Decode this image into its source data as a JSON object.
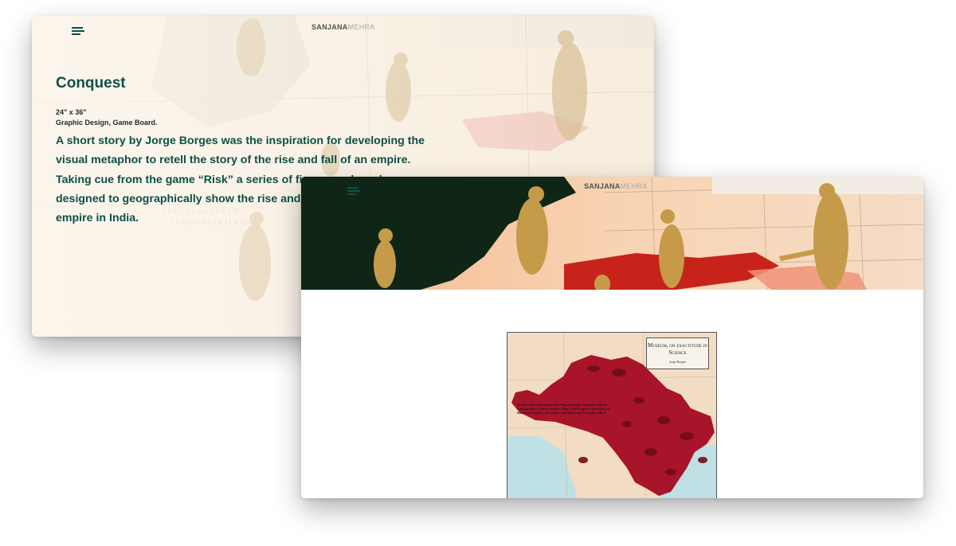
{
  "back_window": {
    "logo_first": "SANJANA",
    "logo_last": "MEHRA",
    "project": {
      "title": "Conquest",
      "size": "24\" x 36\"",
      "category": "Graphic Design, Game Board.",
      "description": "A short story by Jorge Borges was the inspiration for developing the visual metaphor to retell the story of the rise and fall of an empire. Taking cue from the game “Risk” a series of five game boards was designed to geographically show the rise and fall of the British empire in India."
    }
  },
  "front_window": {
    "logo_first": "SANJANA",
    "logo_last": "MEHRA",
    "poster": {
      "label_title": "Museum, on exactitude in Science",
      "label_author": "Jorge Borges",
      "map_text": "In time, those unconscionable Maps no longer satisfied, and the Cartographers Guilds struck a Map of the Empire whose size was that of the Empire, and which coincided point for point with it."
    }
  },
  "colors": {
    "accent": "#0d5048",
    "poster_red": "#a8142a",
    "sea": "#bfe0e4"
  }
}
